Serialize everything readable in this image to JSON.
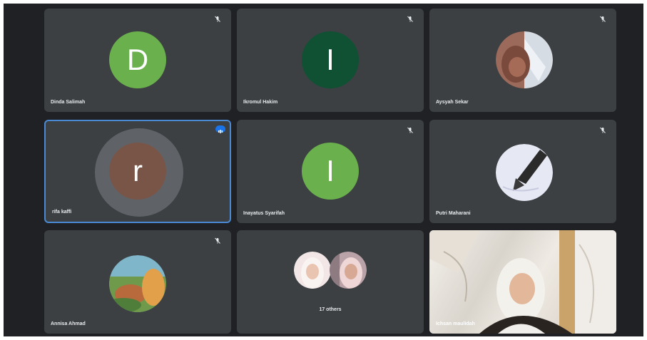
{
  "tiles": [
    {
      "name": "Dinda Salimah",
      "avatar_letter": "D",
      "avatar_color": "#6ab04c"
    },
    {
      "name": "Ikromul Hakim",
      "avatar_letter": "I",
      "avatar_color": "#0f5132"
    },
    {
      "name": "Aysyah Sekar",
      "avatar_type": "photo"
    },
    {
      "name": "rifa kaffi",
      "avatar_letter": "r",
      "avatar_color": "#795548",
      "speaking": true
    },
    {
      "name": "Inayatus Syarifah",
      "avatar_letter": "I",
      "avatar_color": "#6ab04c"
    },
    {
      "name": "Putri Maharani",
      "avatar_type": "photo"
    },
    {
      "name": "Annisa Ahmad",
      "avatar_type": "photo"
    },
    {
      "label": "17 others",
      "avatar_type": "group"
    },
    {
      "name": "Ichsan maulidah",
      "avatar_type": "video"
    }
  ],
  "colors": {
    "background": "#202124",
    "tile": "#3c4043",
    "active_border": "#4a8ad4",
    "speaking_badge": "#1a73e8"
  },
  "icons": {
    "muted": "mic-off-icon",
    "speaking": "audio-level-icon"
  }
}
